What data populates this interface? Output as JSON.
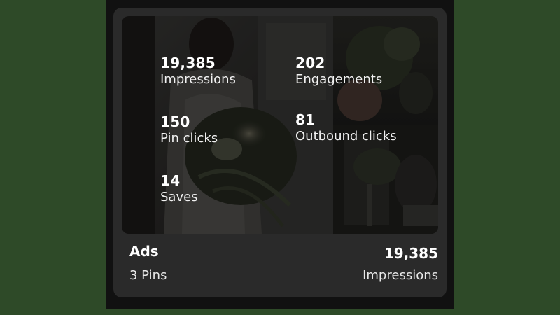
{
  "card": {
    "metrics": [
      {
        "value": "19,385",
        "label": "Impressions"
      },
      {
        "value": "202",
        "label": "Engagements"
      },
      {
        "value": "150",
        "label": "Pin clicks"
      },
      {
        "value": "81",
        "label": "Outbound clicks"
      },
      {
        "value": "14",
        "label": "Saves"
      }
    ],
    "board_name": "Ads",
    "pin_count": "3 Pins",
    "summary_value": "19,385",
    "summary_label": "Impressions"
  },
  "colors": {
    "page_background": "#2e4a28",
    "panel_background": "#111111",
    "card_background": "#2a2a2a",
    "text": "#ffffff"
  }
}
